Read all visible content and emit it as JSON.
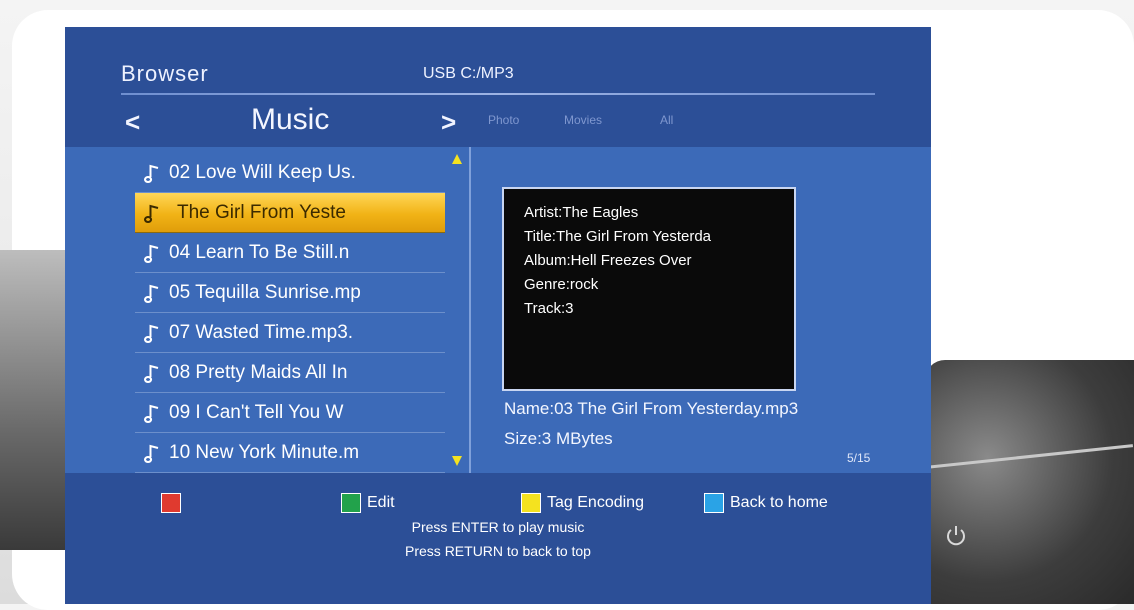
{
  "header": {
    "title": "Browser",
    "path": "USB  C:/MP3"
  },
  "nav": {
    "prev": "<",
    "current": "Music",
    "next": ">",
    "tabs": [
      "Photo",
      "Movies",
      "All"
    ]
  },
  "files": [
    {
      "label": "02 Love Will Keep Us."
    },
    {
      "label": "The Girl From Yeste"
    },
    {
      "label": "04 Learn To Be Still.n"
    },
    {
      "label": "05 Tequilla Sunrise.mp"
    },
    {
      "label": "07 Wasted Time.mp3."
    },
    {
      "label": "08 Pretty Maids All In"
    },
    {
      "label": "09 I Can't Tell You W"
    },
    {
      "label": "10 New York Minute.m"
    }
  ],
  "selected_index": 1,
  "info": {
    "artist": "Artist:The Eagles",
    "title": "Title:The Girl From Yesterda",
    "album": "Album:Hell Freezes Over",
    "genre": "Genre:rock",
    "track": "Track:3",
    "name": "Name:03 The Girl From Yesterday.mp3",
    "size": "Size:3 MBytes",
    "page": "5/15"
  },
  "footer": {
    "red_label": "",
    "green_label": "Edit",
    "yellow_label": "Tag Encoding",
    "blue_label": "Back to home",
    "hint_enter": "Press ENTER to play music",
    "hint_return": "Press RETURN to back to top"
  },
  "colors": {
    "screen_bg": "#2c4f97",
    "panel_bg": "#3c6ab8",
    "selection": "#f1b316",
    "red_key": "#e03a2f",
    "green_key": "#22a24b",
    "yellow_key": "#f4e21f",
    "blue_key": "#2aa3e6"
  },
  "icons": {
    "file": "music-note-icon",
    "scroll_up": "triangle-up-icon",
    "scroll_down": "triangle-down-icon",
    "power": "power-icon"
  }
}
